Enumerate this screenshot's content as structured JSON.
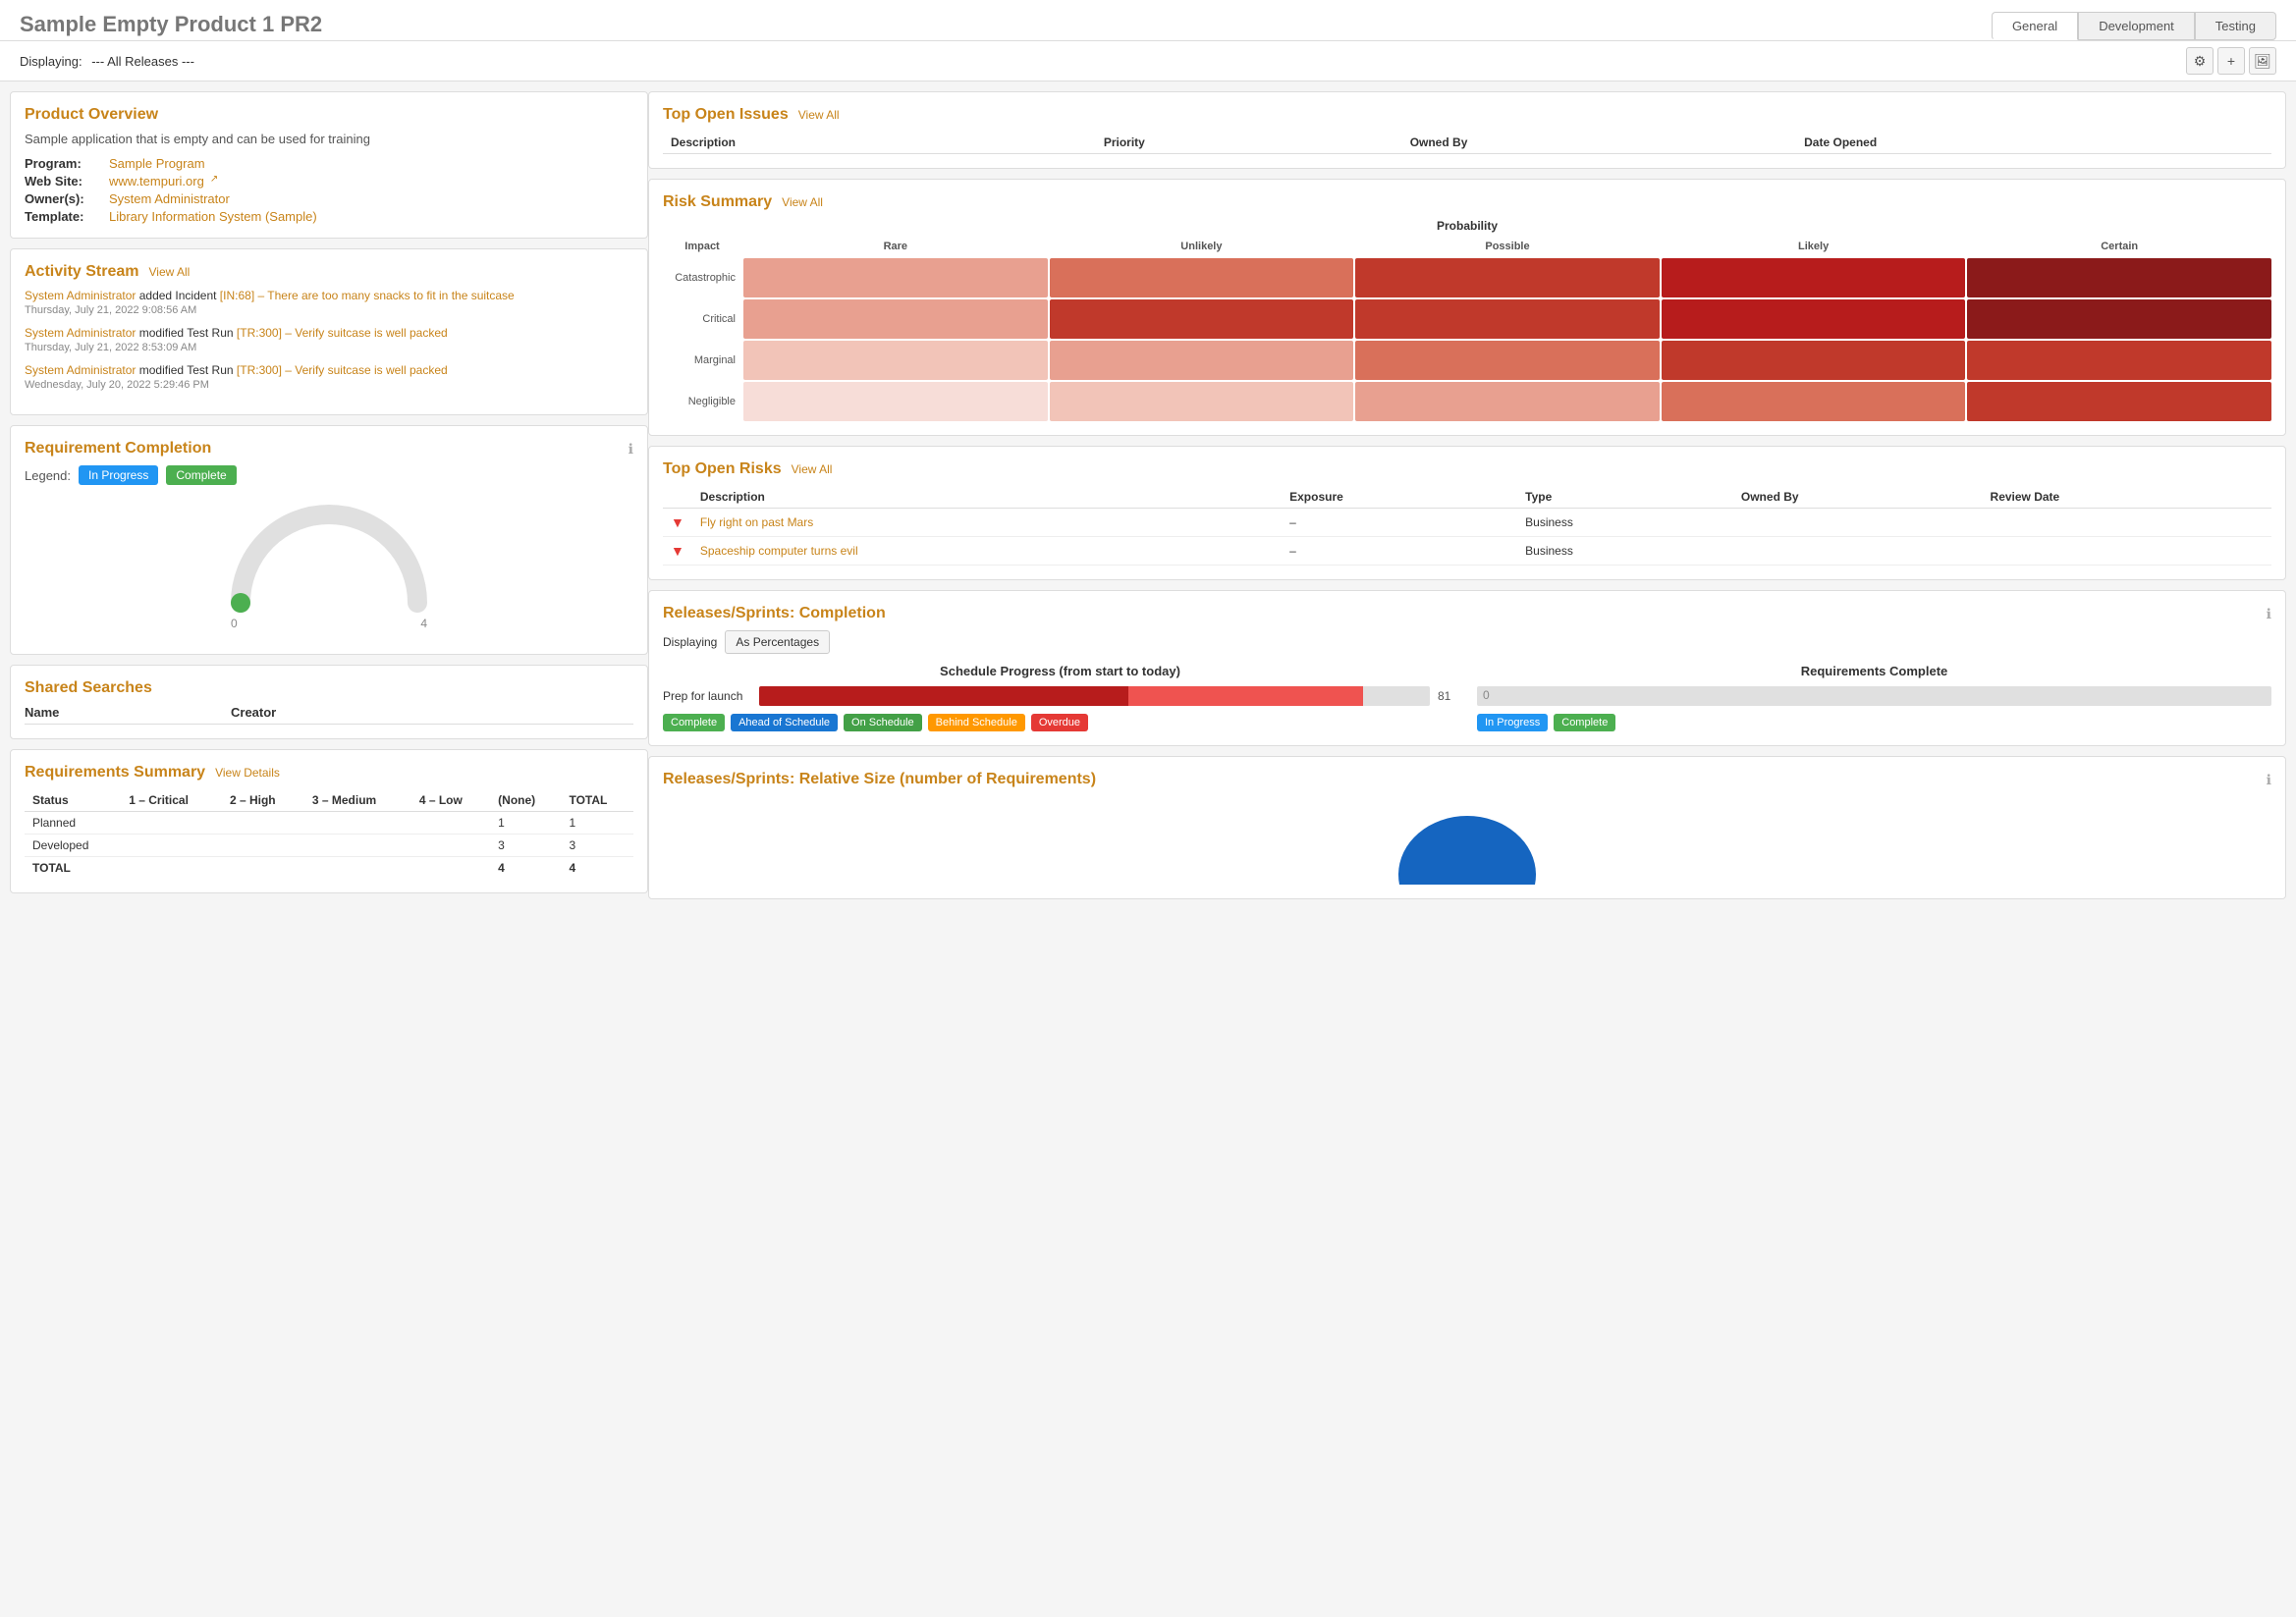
{
  "header": {
    "title_main": "Sample Empty Product 1",
    "title_bold": "PR2",
    "displaying_label": "Displaying:",
    "displaying_value": "--- All Releases ---",
    "tabs": [
      {
        "label": "General",
        "active": true
      },
      {
        "label": "Development",
        "active": false
      },
      {
        "label": "Testing",
        "active": false
      }
    ],
    "icons": [
      "⚙",
      "+",
      "🖼"
    ]
  },
  "product_overview": {
    "title": "Product Overview",
    "description": "Sample application that is empty and can be used for training",
    "fields": [
      {
        "label": "Program:",
        "value": "Sample Program",
        "link": true
      },
      {
        "label": "Web Site:",
        "value": "www.tempuri.org",
        "link": true,
        "external": true
      },
      {
        "label": "Owner(s):",
        "value": "System Administrator",
        "link": true
      },
      {
        "label": "Template:",
        "value": "Library Information System (Sample)",
        "link": true
      }
    ]
  },
  "activity_stream": {
    "title": "Activity Stream",
    "view_all": "View All",
    "items": [
      {
        "user": "System Administrator",
        "action": "added Incident",
        "link_text": "[IN:68] – There are too many snacks to fit in the suitcase",
        "time": "Thursday, July 21, 2022 9:08:56 AM"
      },
      {
        "user": "System Administrator",
        "action": "modified Test Run",
        "link_text": "[TR:300] – Verify suitcase is well packed",
        "time": "Thursday, July 21, 2022 8:53:09 AM"
      },
      {
        "user": "System Administrator",
        "action": "modified Test Run",
        "link_text": "[TR:300] – Verify suitcase is well packed",
        "time": "Wednesday, July 20, 2022 5:29:46 PM"
      }
    ]
  },
  "requirement_completion": {
    "title": "Requirement Completion",
    "legend_label": "Legend:",
    "badge_in_progress": "In Progress",
    "badge_complete": "Complete",
    "gauge_min": "0",
    "gauge_max": "4",
    "gauge_pct": 0
  },
  "shared_searches": {
    "title": "Shared Searches",
    "col_name": "Name",
    "col_creator": "Creator"
  },
  "requirements_summary": {
    "title": "Requirements Summary",
    "view_details": "View Details",
    "columns": [
      "Status",
      "1 – Critical",
      "2 – High",
      "3 – Medium",
      "4 – Low",
      "(None)",
      "TOTAL"
    ],
    "rows": [
      {
        "status": "Planned",
        "critical": "",
        "high": "",
        "medium": "",
        "low": "",
        "none": "1",
        "total": "1"
      },
      {
        "status": "Developed",
        "critical": "",
        "high": "",
        "medium": "",
        "low": "",
        "none": "3",
        "total": "3"
      },
      {
        "status": "TOTAL",
        "critical": "",
        "high": "",
        "medium": "",
        "low": "",
        "none": "4",
        "total": "4"
      }
    ]
  },
  "top_open_issues": {
    "title": "Top Open Issues",
    "view_all": "View All",
    "columns": [
      "Description",
      "Priority",
      "Owned By",
      "Date Opened"
    ]
  },
  "risk_summary": {
    "title": "Risk Summary",
    "view_all": "View All",
    "probability_label": "Probability",
    "impact_label": "Impact",
    "col_headers": [
      "Rare",
      "Unlikely",
      "Possible",
      "Likely",
      "Certain"
    ],
    "row_headers": [
      "Catastrophic",
      "Critical",
      "Marginal",
      "Negligible"
    ],
    "colors": {
      "catastrophic": [
        "#e8a090",
        "#d9705a",
        "#c0392b",
        "#b71c1c",
        "#8b1a1a"
      ],
      "critical": [
        "#e8a090",
        "#c0392b",
        "#c0392b",
        "#b71c1c",
        "#8b1a1a"
      ],
      "marginal": [
        "#f2c4b8",
        "#e8a090",
        "#d9705a",
        "#c0392b",
        "#c0392b"
      ],
      "negligible": [
        "#f7ddd8",
        "#f2c4b8",
        "#e8a090",
        "#d9705a",
        "#c0392b"
      ]
    }
  },
  "top_open_risks": {
    "title": "Top Open Risks",
    "view_all": "View All",
    "columns": [
      "Description",
      "Exposure",
      "Type",
      "Owned By",
      "Review Date"
    ],
    "rows": [
      {
        "indicator": "▼",
        "description": "Fly right on past Mars",
        "exposure": "–",
        "type": "Business",
        "owned_by": "",
        "review_date": ""
      },
      {
        "indicator": "▼",
        "description": "Spaceship computer turns evil",
        "exposure": "–",
        "type": "Business",
        "owned_by": "",
        "review_date": ""
      }
    ]
  },
  "releases_completion": {
    "title": "Releases/Sprints: Completion",
    "displaying_label": "Displaying",
    "as_percentages": "As Percentages",
    "schedule_title": "Schedule Progress (from start to today)",
    "requirements_title": "Requirements Complete",
    "rows": [
      {
        "label": "Prep for launch",
        "bar_dark_pct": 55,
        "bar_red_pct": 35,
        "value": "81",
        "req_complete_pct": 0,
        "req_value": "0"
      }
    ],
    "schedule_badges": [
      "Complete",
      "Ahead of Schedule",
      "On Schedule",
      "Behind Schedule",
      "Overdue"
    ],
    "req_badges": [
      "In Progress",
      "Complete"
    ]
  },
  "releases_size": {
    "title": "Releases/Sprints: Relative Size (number of Requirements)"
  }
}
